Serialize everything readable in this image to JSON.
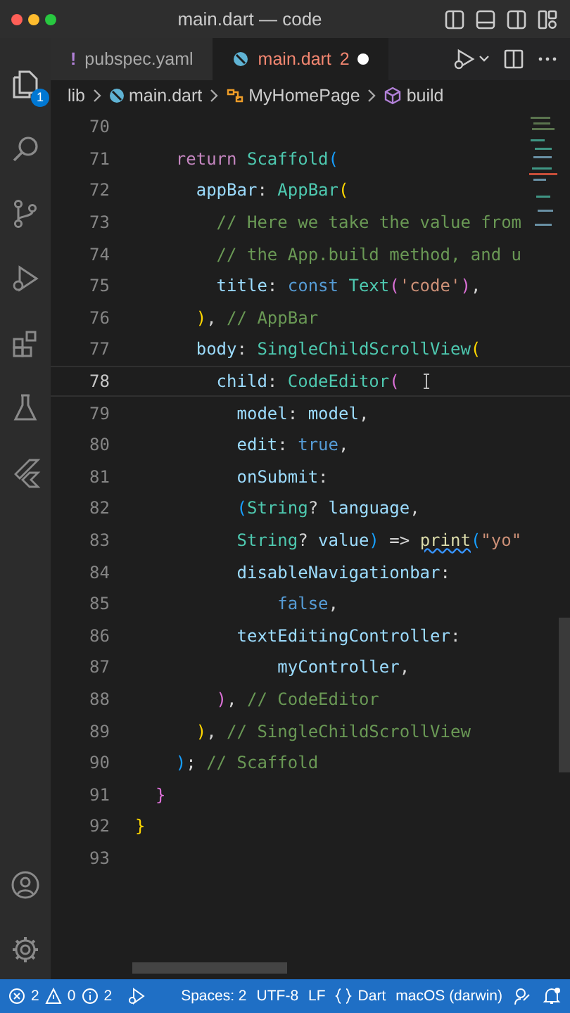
{
  "window": {
    "title": "main.dart — code"
  },
  "activity_bar": {
    "top": [
      {
        "kind": "files",
        "badge": "1"
      },
      {
        "kind": "search"
      },
      {
        "kind": "source-control"
      },
      {
        "kind": "debug"
      },
      {
        "kind": "extensions"
      },
      {
        "kind": "testing"
      },
      {
        "kind": "flutter"
      }
    ],
    "bottom": [
      {
        "kind": "account"
      },
      {
        "kind": "settings"
      }
    ]
  },
  "tabs": [
    {
      "icon": "!",
      "label": "pubspec.yaml",
      "selected": false,
      "modified": false
    },
    {
      "label": "main.dart",
      "problems": "2",
      "selected": true,
      "modified": true
    }
  ],
  "breadcrumb": [
    {
      "kind": "folder",
      "label": "lib"
    },
    {
      "kind": "file",
      "label": "main.dart"
    },
    {
      "kind": "class",
      "label": "MyHomePage"
    },
    {
      "kind": "method",
      "label": "build"
    }
  ],
  "editor": {
    "lines": [
      {
        "number": "70",
        "current": false
      },
      {
        "number": "71",
        "current": false,
        "tokens": [
          {
            "text": "    return",
            "kind": "kw"
          },
          {
            "text": " Scaffold",
            "kind": "type"
          },
          {
            "text": "(",
            "kind": "b"
          }
        ]
      },
      {
        "number": "72",
        "current": false,
        "tokens": [
          {
            "text": "      appBar",
            "kind": "prop"
          },
          {
            "text": ": ",
            "kind": "punct"
          },
          {
            "text": "AppBar",
            "kind": "type"
          },
          {
            "text": "(",
            "kind": "y"
          }
        ]
      },
      {
        "number": "73",
        "current": false,
        "tokens": [
          {
            "text": "        // Here we take the value from",
            "kind": "comment"
          }
        ]
      },
      {
        "number": "74",
        "current": false,
        "tokens": [
          {
            "text": "        // the App.build method, and u",
            "kind": "comment"
          }
        ]
      },
      {
        "number": "75",
        "current": false,
        "tokens": [
          {
            "text": "        title",
            "kind": "prop"
          },
          {
            "text": ": ",
            "kind": "punct"
          },
          {
            "text": "const",
            "kind": "const"
          },
          {
            "text": " Text",
            "kind": "type"
          },
          {
            "text": "(",
            "kind": "p"
          },
          {
            "text": "'code'",
            "kind": "str"
          },
          {
            "text": ")",
            "kind": "p"
          },
          {
            "text": ",",
            "kind": "punct"
          }
        ]
      },
      {
        "number": "76",
        "current": false,
        "tokens": [
          {
            "text": "      )",
            "kind": "y"
          },
          {
            "text": ", ",
            "kind": "punct"
          },
          {
            "text": "// AppBar",
            "kind": "comment"
          }
        ]
      },
      {
        "number": "77",
        "current": false,
        "tokens": [
          {
            "text": "      body",
            "kind": "prop"
          },
          {
            "text": ": ",
            "kind": "punct"
          },
          {
            "text": "SingleChildScrollView",
            "kind": "type"
          },
          {
            "text": "(",
            "kind": "y"
          }
        ]
      },
      {
        "number": "78",
        "current": true,
        "tokens": [
          {
            "text": "        child",
            "kind": "prop"
          },
          {
            "text": ": ",
            "kind": "punct"
          },
          {
            "text": "CodeEditor",
            "kind": "type"
          },
          {
            "text": "(",
            "kind": "p"
          }
        ]
      },
      {
        "number": "79",
        "current": false,
        "tokens": [
          {
            "text": "          model",
            "kind": "prop"
          },
          {
            "text": ": ",
            "kind": "punct"
          },
          {
            "text": "model",
            "kind": "prop"
          },
          {
            "text": ",",
            "kind": "punct"
          }
        ]
      },
      {
        "number": "80",
        "current": false,
        "tokens": [
          {
            "text": "          edit",
            "kind": "prop"
          },
          {
            "text": ": ",
            "kind": "punct"
          },
          {
            "text": "true",
            "kind": "const"
          },
          {
            "text": ",",
            "kind": "punct"
          }
        ]
      },
      {
        "number": "81",
        "current": false,
        "tokens": [
          {
            "text": "          onSubmit",
            "kind": "prop"
          },
          {
            "text": ":",
            "kind": "punct"
          }
        ]
      },
      {
        "number": "82",
        "current": false,
        "tokens": [
          {
            "text": "          (",
            "kind": "b"
          },
          {
            "text": "String",
            "kind": "type"
          },
          {
            "text": "? ",
            "kind": "punct"
          },
          {
            "text": "language",
            "kind": "prop"
          },
          {
            "text": ",",
            "kind": "punct"
          }
        ]
      },
      {
        "number": "83",
        "current": false,
        "tokens": [
          {
            "text": "          String",
            "kind": "type"
          },
          {
            "text": "? ",
            "kind": "punct"
          },
          {
            "text": "value",
            "kind": "prop"
          },
          {
            "text": ")",
            "kind": "b"
          },
          {
            "text": " => ",
            "kind": "punct"
          },
          {
            "text": "print",
            "kind": "fn",
            "squiggle": true
          },
          {
            "text": "(",
            "kind": "b"
          },
          {
            "text": "\"yo\"",
            "kind": "str"
          }
        ]
      },
      {
        "number": "84",
        "current": false,
        "tokens": [
          {
            "text": "          disableNavigationbar",
            "kind": "prop"
          },
          {
            "text": ":",
            "kind": "punct"
          }
        ]
      },
      {
        "number": "85",
        "current": false,
        "tokens": [
          {
            "text": "              false",
            "kind": "const"
          },
          {
            "text": ",",
            "kind": "punct"
          }
        ]
      },
      {
        "number": "86",
        "current": false,
        "tokens": [
          {
            "text": "          textEditingController",
            "kind": "prop"
          },
          {
            "text": ":",
            "kind": "punct"
          }
        ]
      },
      {
        "number": "87",
        "current": false,
        "tokens": [
          {
            "text": "              myController",
            "kind": "prop"
          },
          {
            "text": ",",
            "kind": "punct"
          }
        ]
      },
      {
        "number": "88",
        "current": false,
        "tokens": [
          {
            "text": "        )",
            "kind": "p"
          },
          {
            "text": ", ",
            "kind": "punct"
          },
          {
            "text": "// CodeEditor",
            "kind": "comment"
          }
        ]
      },
      {
        "number": "89",
        "current": false,
        "tokens": [
          {
            "text": "      )",
            "kind": "y"
          },
          {
            "text": ", ",
            "kind": "punct"
          },
          {
            "text": "// SingleChildScrollView",
            "kind": "comment"
          }
        ]
      },
      {
        "number": "90",
        "current": false,
        "tokens": [
          {
            "text": "    )",
            "kind": "b"
          },
          {
            "text": "; ",
            "kind": "punct"
          },
          {
            "text": "// Scaffold",
            "kind": "comment"
          }
        ]
      },
      {
        "number": "91",
        "current": false,
        "tokens": [
          {
            "text": "  }",
            "kind": "p"
          }
        ]
      },
      {
        "number": "92",
        "current": false,
        "tokens": [
          {
            "text": "}",
            "kind": "y"
          }
        ]
      },
      {
        "number": "93",
        "current": false
      }
    ]
  },
  "status_bar": {
    "left": [
      {
        "kind": "error",
        "label": "2"
      },
      {
        "kind": "warning",
        "label": "0"
      },
      {
        "kind": "info",
        "label": "2"
      },
      {
        "kind": "debug"
      }
    ],
    "right": [
      {
        "kind": "text",
        "label": "Spaces: 2"
      },
      {
        "kind": "text",
        "label": "UTF-8"
      },
      {
        "kind": "text",
        "label": "LF"
      },
      {
        "kind": "language",
        "label": "Dart"
      },
      {
        "kind": "text",
        "label": "macOS (darwin)"
      },
      {
        "kind": "feedback"
      },
      {
        "kind": "bell"
      }
    ]
  }
}
